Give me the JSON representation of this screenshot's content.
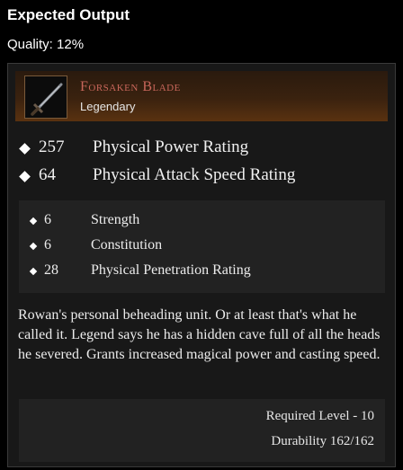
{
  "header": {
    "title": "Expected Output",
    "quality": "Quality: 12%"
  },
  "item": {
    "icon": "sword-icon",
    "name": "Forsaken Blade",
    "rarity": "Legendary",
    "name_color": "#c8665a",
    "main_stats": [
      {
        "value": "257",
        "name": "Physical Power Rating"
      },
      {
        "value": "64",
        "name": "Physical Attack Speed Rating"
      }
    ],
    "sub_stats": [
      {
        "value": "6",
        "name": "Strength"
      },
      {
        "value": "6",
        "name": "Constitution"
      },
      {
        "value": "28",
        "name": "Physical Penetration Rating"
      }
    ],
    "description": "Rowan's personal beheading unit. Or at least that's what he called it. Legend says he has a hidden cave full of all the heads he severed. Grants increased magical power and casting speed.",
    "required_level": "Required Level - 10",
    "durability": "Durability 162/162"
  }
}
